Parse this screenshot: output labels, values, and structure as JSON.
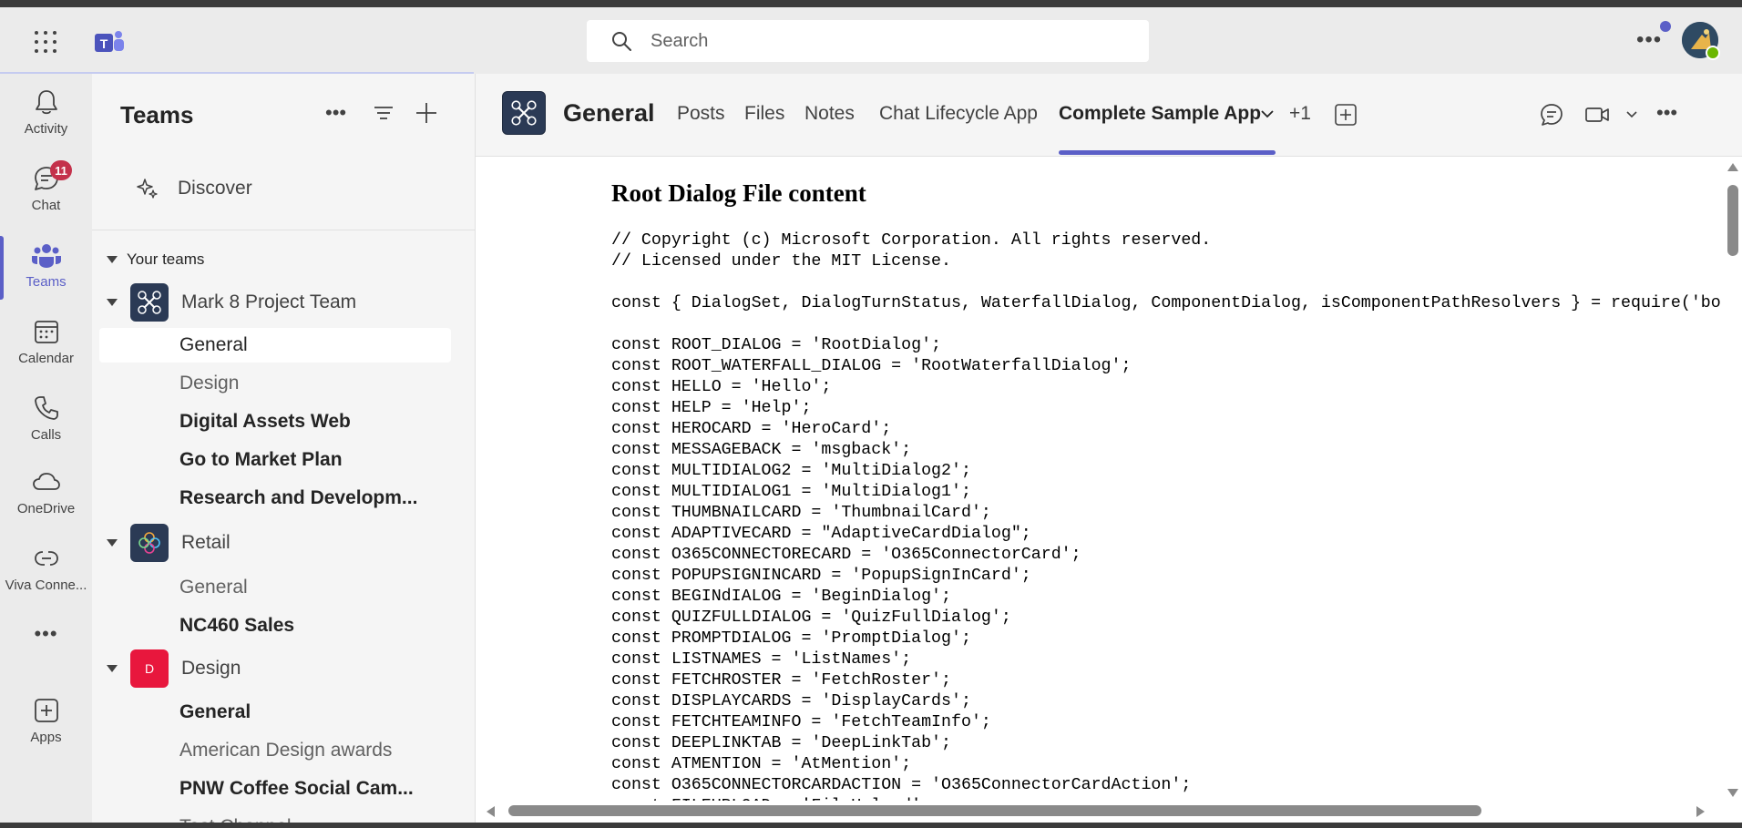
{
  "search": {
    "placeholder": "Search"
  },
  "rail": [
    {
      "label": "Activity",
      "icon": "bell-icon"
    },
    {
      "label": "Chat",
      "icon": "chat-icon",
      "badge": "11"
    },
    {
      "label": "Teams",
      "icon": "teams-icon"
    },
    {
      "label": "Calendar",
      "icon": "calendar-icon"
    },
    {
      "label": "Calls",
      "icon": "phone-icon"
    },
    {
      "label": "OneDrive",
      "icon": "cloud-icon"
    },
    {
      "label": "Viva Conne...",
      "icon": "viva-connections-icon"
    },
    {
      "label": "Apps",
      "icon": "apps-icon"
    }
  ],
  "panel": {
    "title": "Teams",
    "discover": "Discover",
    "section": "Your teams",
    "teams": [
      {
        "name": "Mark 8 Project Team",
        "avatar_color": "#2b3a55"
      },
      {
        "name": "Retail",
        "avatar_color": "#2b3a55"
      },
      {
        "name": "Design",
        "avatar_color": "#e8173d",
        "initial": "D"
      }
    ],
    "channels": [
      "General",
      "Design",
      "Digital Assets Web",
      "Go to Market Plan",
      "Research and Developm...",
      "General",
      "NC460 Sales",
      "General",
      "American Design awards",
      "PNW Coffee Social Cam...",
      "Test Channel"
    ]
  },
  "header": {
    "channel": "General",
    "tabs": [
      "Posts",
      "Files",
      "Notes",
      "Chat Lifecycle App",
      "Complete Sample App",
      "+1"
    ]
  },
  "content": {
    "title": "Root Dialog File content",
    "code": [
      "// Copyright (c) Microsoft Corporation. All rights reserved.",
      "// Licensed under the MIT License.",
      "",
      "const { DialogSet, DialogTurnStatus, WaterfallDialog, ComponentDialog, isComponentPathResolvers } = require('botbuilder-dialogs');",
      "",
      "const ROOT_DIALOG = 'RootDialog';",
      "const ROOT_WATERFALL_DIALOG = 'RootWaterfallDialog';",
      "const HELLO = 'Hello';",
      "const HELP = 'Help';",
      "const HEROCARD = 'HeroCard';",
      "const MESSAGEBACK = 'msgback';",
      "const MULTIDIALOG2 = 'MultiDialog2';",
      "const MULTIDIALOG1 = 'MultiDialog1';",
      "const THUMBNAILCARD = 'ThumbnailCard';",
      "const ADAPTIVECARD = \"AdaptiveCardDialog\";",
      "const O365CONNECTORECARD = 'O365ConnectorCard';",
      "const POPUPSIGNINCARD = 'PopupSignInCard';",
      "const BEGINdIALOG = 'BeginDialog';",
      "const QUIZFULLDIALOG = 'QuizFullDialog';",
      "const PROMPTDIALOG = 'PromptDialog';",
      "const LISTNAMES = 'ListNames';",
      "const FETCHROSTER = 'FetchRoster';",
      "const DISPLAYCARDS = 'DisplayCards';",
      "const FETCHTEAMINFO = 'FetchTeamInfo';",
      "const DEEPLINKTAB = 'DeepLinkTab';",
      "const ATMENTION = 'AtMention';",
      "const O365CONNECTORCARDACTION = 'O365ConnectorCardAction';",
      "const FILEUPLOAD = 'FileUpload';"
    ]
  }
}
